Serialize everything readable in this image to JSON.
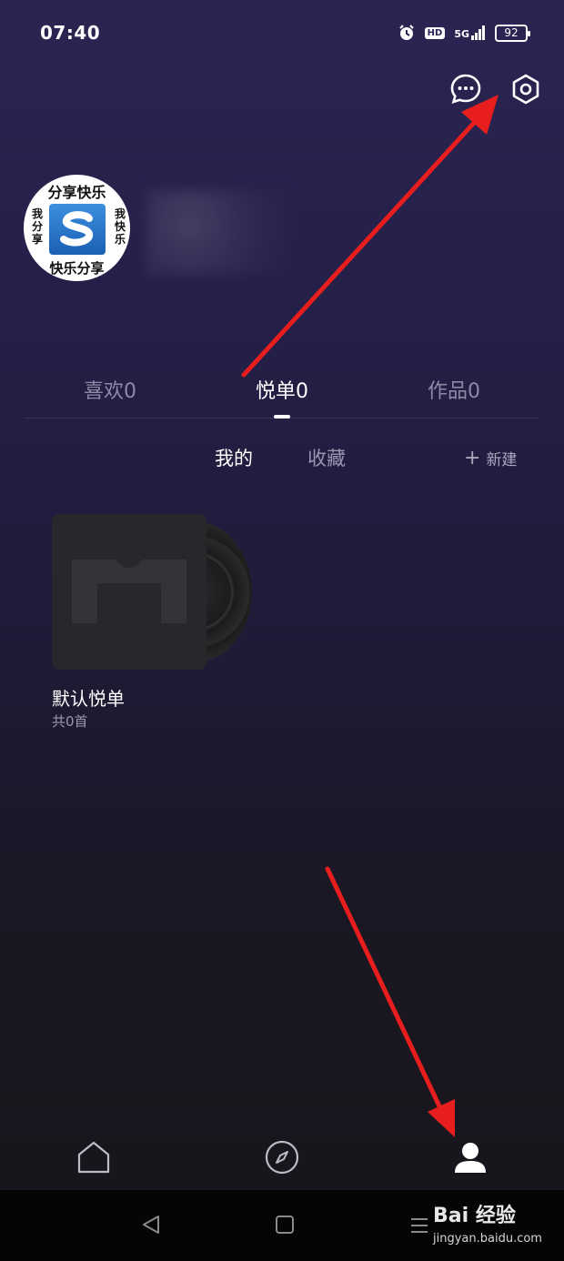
{
  "status_bar": {
    "time": "07:40",
    "hd": "HD",
    "network": "5G",
    "battery": "92",
    "icons": [
      "alarm-icon",
      "hd-icon",
      "signal-icon",
      "battery-icon"
    ]
  },
  "header": {
    "message_icon": "chat-bubble-icon",
    "settings_icon": "settings-ring-icon"
  },
  "profile": {
    "avatar_text": {
      "top": "分享快乐",
      "bottom": "快乐分享",
      "left": "我分享",
      "right": "我快乐"
    }
  },
  "main_tabs": [
    {
      "label": "喜欢0",
      "active": false
    },
    {
      "label": "悦单0",
      "active": true
    },
    {
      "label": "作品0",
      "active": false
    }
  ],
  "sub_tabs": [
    {
      "label": "我的",
      "active": true
    },
    {
      "label": "收藏",
      "active": false
    }
  ],
  "new_button": {
    "icon": "+",
    "label": "新建"
  },
  "playlists": [
    {
      "title": "默认悦单",
      "count": "共0首"
    }
  ],
  "bottom_nav": [
    {
      "icon": "home-icon",
      "active": false
    },
    {
      "icon": "compass-icon",
      "active": false
    },
    {
      "icon": "person-icon",
      "active": true
    }
  ],
  "watermark": {
    "brand": "Bai 经验",
    "url": "jingyan.baidu.com"
  },
  "colors": {
    "bg_top": "#2a2452",
    "bg_bottom": "#18161c",
    "accent_arrow": "#e81e1e",
    "inactive_text": "#8e8aa6"
  }
}
